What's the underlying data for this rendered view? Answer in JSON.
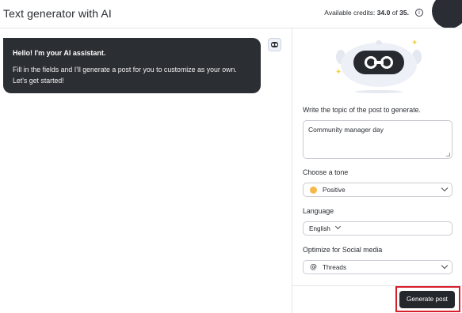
{
  "header": {
    "title": "Text generator with AI",
    "credits_label": "Available credits:",
    "credits_used": "34.0",
    "credits_of": "of",
    "credits_total": "35.",
    "info_icon": "info-icon"
  },
  "chat": {
    "greeting": "Hello! I'm your AI assistant.",
    "line1": "Fill in the fields and I'll generate a post for you to customize as your own.",
    "line2": "Let's get started!"
  },
  "form": {
    "topic_label": "Write the topic of the post to generate.",
    "topic_value": "Community manager day",
    "tone_label": "Choose a tone",
    "tone_value": "Positive",
    "language_label": "Language",
    "language_value": "English",
    "social_label": "Optimize for Social media",
    "social_value": "Threads",
    "generate_label": "Generate post"
  },
  "colors": {
    "bubble_bg": "#2b2e33",
    "button_bg": "#24272c",
    "highlight": "#d71f2b",
    "sparkle": "#f3d24b"
  }
}
